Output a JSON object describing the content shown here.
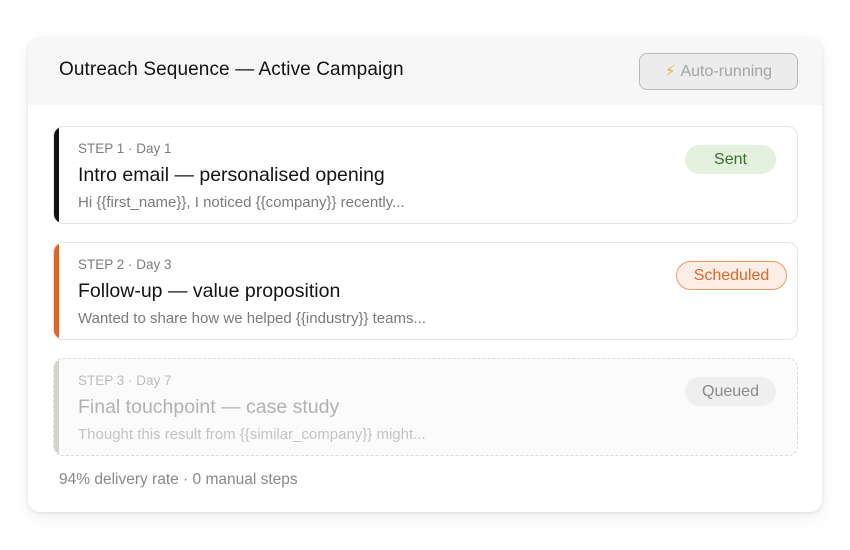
{
  "header": {
    "title": "Outreach Sequence — Active Campaign",
    "auto_button_label": "Auto-running",
    "auto_button_icon": "lightning-bolt-icon"
  },
  "steps": [
    {
      "meta": "STEP 1 · Day 1",
      "title": "Intro email — personalised opening",
      "preview": "Hi {{first_name}}, I noticed {{company}} recently...",
      "status": "Sent",
      "accent_color": "#111111"
    },
    {
      "meta": "STEP 2 · Day 3",
      "title": "Follow-up — value proposition",
      "preview": "Wanted to share how we helped {{industry}} teams...",
      "status": "Scheduled",
      "accent_color": "#e8621f"
    },
    {
      "meta": "STEP 3 · Day 7",
      "title": "Final touchpoint — case study",
      "preview": "Thought this result from {{similar_company}} might...",
      "status": "Queued",
      "accent_color": "#d6d3cc"
    }
  ],
  "footer": {
    "stats": "94% delivery rate · 0 manual steps"
  }
}
